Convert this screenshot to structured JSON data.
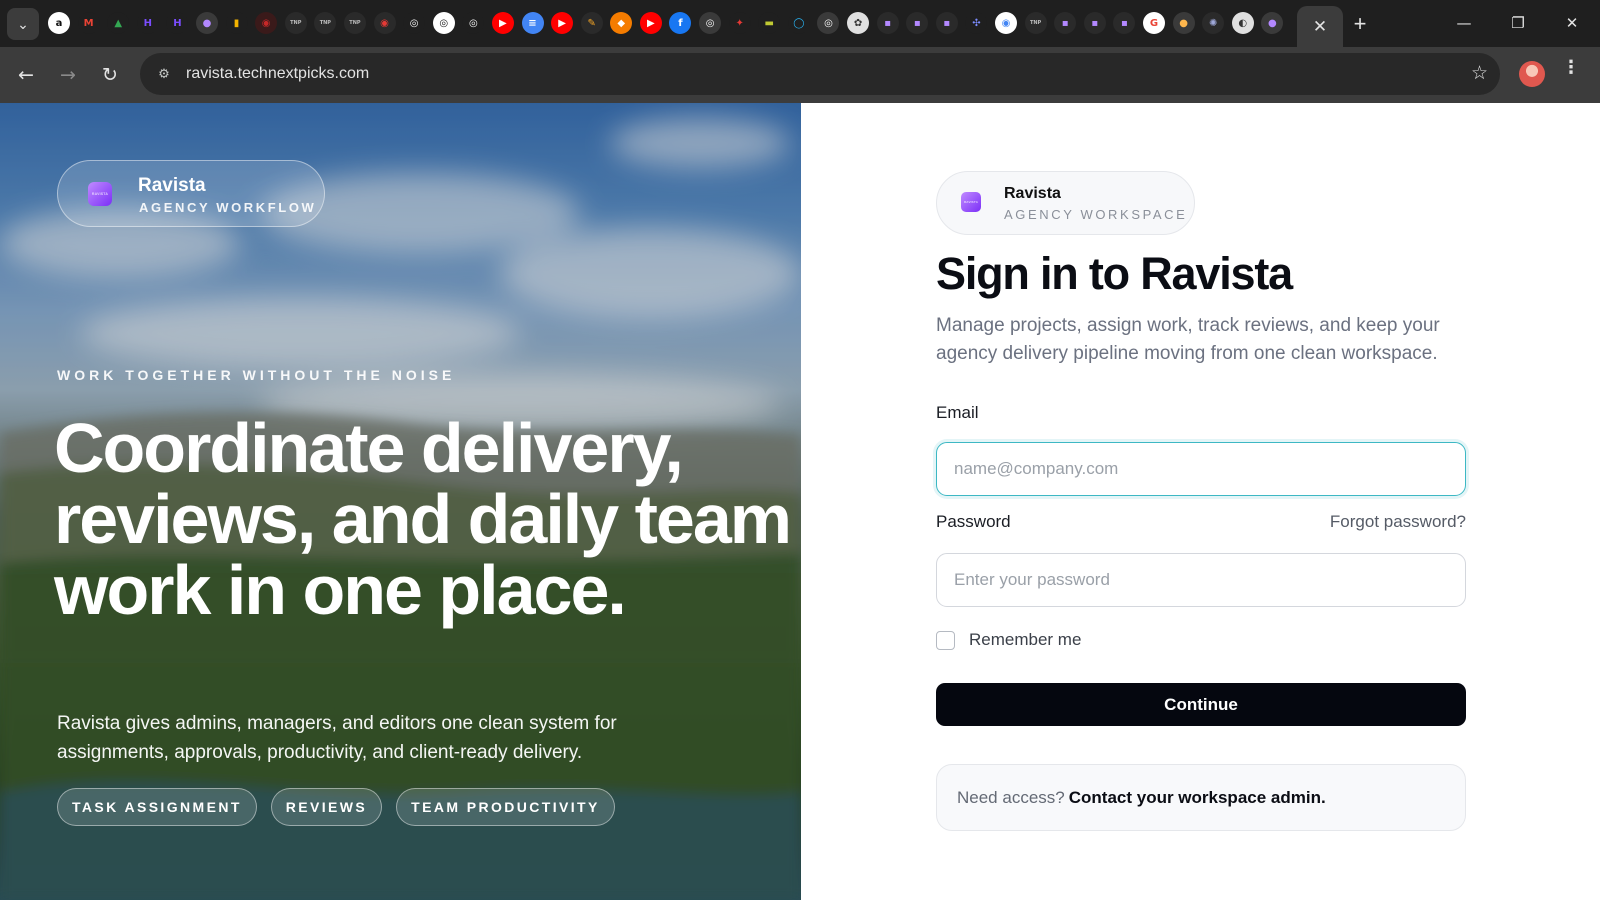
{
  "browser": {
    "url": "ravista.technextpicks.com",
    "favicons": [
      {
        "name": "amazon-icon",
        "glyph": "a",
        "color": "#ffffff",
        "fg": "#111111"
      },
      {
        "name": "gmail-icon",
        "glyph": "M",
        "color": "#1f1f1f",
        "fg": "#ea4335"
      },
      {
        "name": "analytics-icon",
        "glyph": "▲",
        "color": "#1f1f1f",
        "fg": "#34a853"
      },
      {
        "name": "h-icon",
        "glyph": "H",
        "color": "#1f1f1f",
        "fg": "#7b4dff"
      },
      {
        "name": "h-icon",
        "glyph": "H",
        "color": "#1f1f1f",
        "fg": "#7b4dff"
      },
      {
        "name": "ravista-icon",
        "glyph": "●",
        "color": "#3a3a3a",
        "fg": "#b388ff"
      },
      {
        "name": "chart-icon",
        "glyph": "▮",
        "color": "#1f1f1f",
        "fg": "#f4b400"
      },
      {
        "name": "tnp-icon",
        "glyph": "◉",
        "color": "#3a1a1a",
        "fg": "#c62828"
      },
      {
        "name": "tnp-icon",
        "glyph": "TNP",
        "color": "#2a2a2a",
        "fg": "#bdbdbd"
      },
      {
        "name": "tnp-icon",
        "glyph": "TNP",
        "color": "#2a2a2a",
        "fg": "#bdbdbd"
      },
      {
        "name": "tnp-icon",
        "glyph": "TNP",
        "color": "#2a2a2a",
        "fg": "#bdbdbd"
      },
      {
        "name": "tnp-icon",
        "glyph": "◉",
        "color": "#2a2a2a",
        "fg": "#e53935"
      },
      {
        "name": "github-icon",
        "glyph": "◎",
        "color": "#1f1f1f",
        "fg": "#ffffff"
      },
      {
        "name": "github-icon",
        "glyph": "◎",
        "color": "#ffffff",
        "fg": "#111111"
      },
      {
        "name": "github-icon",
        "glyph": "◎",
        "color": "#1f1f1f",
        "fg": "#ffffff"
      },
      {
        "name": "youtube-icon",
        "glyph": "▶",
        "color": "#ff0000",
        "fg": "#ffffff"
      },
      {
        "name": "docs-icon",
        "glyph": "≡",
        "color": "#4285f4",
        "fg": "#ffffff"
      },
      {
        "name": "youtube-icon",
        "glyph": "▶",
        "color": "#ff0000",
        "fg": "#ffffff"
      },
      {
        "name": "pen-icon",
        "glyph": "✎",
        "color": "#2a2a2a",
        "fg": "#f9a825"
      },
      {
        "name": "bookmark-icon",
        "glyph": "◆",
        "color": "#f57c00",
        "fg": "#ffffff"
      },
      {
        "name": "youtube-icon",
        "glyph": "▶",
        "color": "#ff0000",
        "fg": "#ffffff"
      },
      {
        "name": "facebook-icon",
        "glyph": "f",
        "color": "#1877f2",
        "fg": "#ffffff"
      },
      {
        "name": "compass-icon",
        "glyph": "◎",
        "color": "#3a3a3a",
        "fg": "#ffffff"
      },
      {
        "name": "maple-leaf-icon",
        "glyph": "✦",
        "color": "#1f1f1f",
        "fg": "#e53935"
      },
      {
        "name": "card-icon",
        "glyph": "▬",
        "color": "#1f1f1f",
        "fg": "#c0ca33"
      },
      {
        "name": "circle-icon",
        "glyph": "◯",
        "color": "#1f1f1f",
        "fg": "#29b6f6"
      },
      {
        "name": "ai-icon",
        "glyph": "◎",
        "color": "#3a3a3a",
        "fg": "#ffffff"
      },
      {
        "name": "openai-icon",
        "glyph": "✿",
        "color": "#e0e0e0",
        "fg": "#333333"
      },
      {
        "name": "ravista-icon",
        "glyph": "▪",
        "color": "#2a2a2a",
        "fg": "#b388ff"
      },
      {
        "name": "ravista-icon",
        "glyph": "▪",
        "color": "#2a2a2a",
        "fg": "#b388ff"
      },
      {
        "name": "ravista-icon",
        "glyph": "▪",
        "color": "#2a2a2a",
        "fg": "#b388ff"
      },
      {
        "name": "sparkle-icon",
        "glyph": "✣",
        "color": "#1f1f1f",
        "fg": "#7c8cff"
      },
      {
        "name": "chrome-icon",
        "glyph": "◉",
        "color": "#ffffff",
        "fg": "#4285f4"
      },
      {
        "name": "tnp-icon",
        "glyph": "TNP",
        "color": "#2a2a2a",
        "fg": "#bdbdbd"
      },
      {
        "name": "ravista-icon",
        "glyph": "▪",
        "color": "#2a2a2a",
        "fg": "#b388ff"
      },
      {
        "name": "ravista-icon",
        "glyph": "▪",
        "color": "#2a2a2a",
        "fg": "#b388ff"
      },
      {
        "name": "ravista-icon",
        "glyph": "▪",
        "color": "#2a2a2a",
        "fg": "#b388ff"
      },
      {
        "name": "google-icon",
        "glyph": "G",
        "color": "#ffffff",
        "fg": "#ea4335"
      },
      {
        "name": "avatar-icon",
        "glyph": "●",
        "color": "#3a3a3a",
        "fg": "#ffb74d"
      },
      {
        "name": "gear-icon",
        "glyph": "✺",
        "color": "#2a2a2a",
        "fg": "#9fa8da"
      },
      {
        "name": "globe-icon",
        "glyph": "◐",
        "color": "#e0e0e0",
        "fg": "#333333"
      },
      {
        "name": "ravista-icon",
        "glyph": "●",
        "color": "#3a3a3a",
        "fg": "#b388ff"
      }
    ]
  },
  "brand": {
    "name": "Ravista",
    "logo_text": "RAVISTA",
    "hero_tagline": "AGENCY WORKFLOW",
    "form_tagline": "AGENCY WORKSPACE"
  },
  "hero": {
    "eyebrow": "WORK TOGETHER WITHOUT THE NOISE",
    "headline": "Coordinate delivery, reviews, and daily team work in one place.",
    "description": "Ravista gives admins, managers, and editors one clean system for assignments, approvals, productivity, and client-ready delivery.",
    "chips": [
      "TASK ASSIGNMENT",
      "REVIEWS",
      "TEAM PRODUCTIVITY"
    ]
  },
  "form": {
    "title": "Sign in to Ravista",
    "subtitle": "Manage projects, assign work, track reviews, and keep your agency delivery pipeline moving from one clean workspace.",
    "email_label": "Email",
    "email_placeholder": "name@company.com",
    "email_value": "",
    "password_label": "Password",
    "password_placeholder": "Enter your password",
    "forgot_label": "Forgot password?",
    "remember_label": "Remember me",
    "remember_checked": false,
    "continue_label": "Continue",
    "access_question": "Need access?",
    "access_link": "Contact your workspace admin."
  },
  "colors": {
    "accent_focus": "#3db8c4",
    "primary_button": "#05070f",
    "logo_purple": "#7b2ff7"
  }
}
